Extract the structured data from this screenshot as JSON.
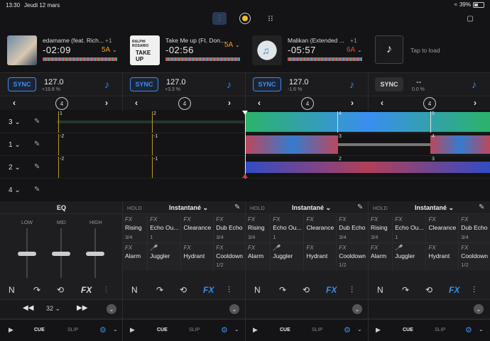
{
  "status": {
    "time": "13:30",
    "date": "Jeudi 12 mars",
    "battery": "39%"
  },
  "top_icons": [
    "mixer-icon",
    "record-icon",
    "grid-icon"
  ],
  "decks": [
    {
      "title": "edamame (feat. Rich...",
      "time": "-02:09",
      "key": "5A",
      "offset": "+1",
      "bpm": "127.0",
      "bpm_sub": "+19.8 %",
      "sync": "SYNC",
      "key_color": "#f0a020"
    },
    {
      "title": "Take Me up (Ft. Don...",
      "time": "-02:56",
      "key": "5A",
      "offset": "",
      "bpm": "127.0",
      "bpm_sub": "+3.3 %",
      "sync": "SYNC",
      "key_color": "#f0a020"
    },
    {
      "title": "Malikan (Extended ...",
      "time": "-05:57",
      "key": "6A",
      "offset": "+1",
      "bpm": "127.0",
      "bpm_sub": "-1.6 %",
      "sync": "SYNC",
      "key_color": "#e0502a"
    },
    {
      "title": "Tap to load",
      "bpm": "--",
      "bpm_sub": "0.0 %",
      "sync": "SYNC"
    }
  ],
  "loop_size": "4",
  "lanes": [
    {
      "num": "3"
    },
    {
      "num": "1"
    },
    {
      "num": "2"
    },
    {
      "num": "4"
    }
  ],
  "beat_markers": {
    "lane1": [
      "1",
      "2",
      "4",
      "5"
    ],
    "lane2": [
      "-2",
      "-1",
      "3",
      "4"
    ],
    "lane3": [
      "-2",
      "-1",
      "2",
      "3"
    ]
  },
  "eq": {
    "title": "EQ",
    "low": "LOW",
    "mid": "MID",
    "high": "HIGH",
    "jump": "32"
  },
  "fx_panels": [
    {
      "hold": "HOLD",
      "snapshot": "Instantané"
    },
    {
      "hold": "HOLD",
      "snapshot": "Instantané"
    },
    {
      "hold": "HOLD",
      "snapshot": "Instantané"
    }
  ],
  "fx_items": [
    {
      "fx": "FX",
      "name": "Rising",
      "q": "3/4"
    },
    {
      "fx": "FX",
      "name": "Echo Ou...",
      "q": "1"
    },
    {
      "fx": "FX",
      "name": "Clearance",
      "q": ""
    },
    {
      "fx": "FX",
      "name": "Dub Echo",
      "q": "3/4"
    },
    {
      "fx": "FX",
      "name": "Alarm",
      "q": ""
    },
    {
      "fx": "",
      "name": "Juggler",
      "q": ""
    },
    {
      "fx": "FX",
      "name": "Hydrant",
      "q": ""
    },
    {
      "fx": "FX",
      "name": "Cooldown",
      "q": "1/2"
    }
  ],
  "controls": {
    "cue": "CUE",
    "slip": "SLIP",
    "fx_label": "FX"
  }
}
